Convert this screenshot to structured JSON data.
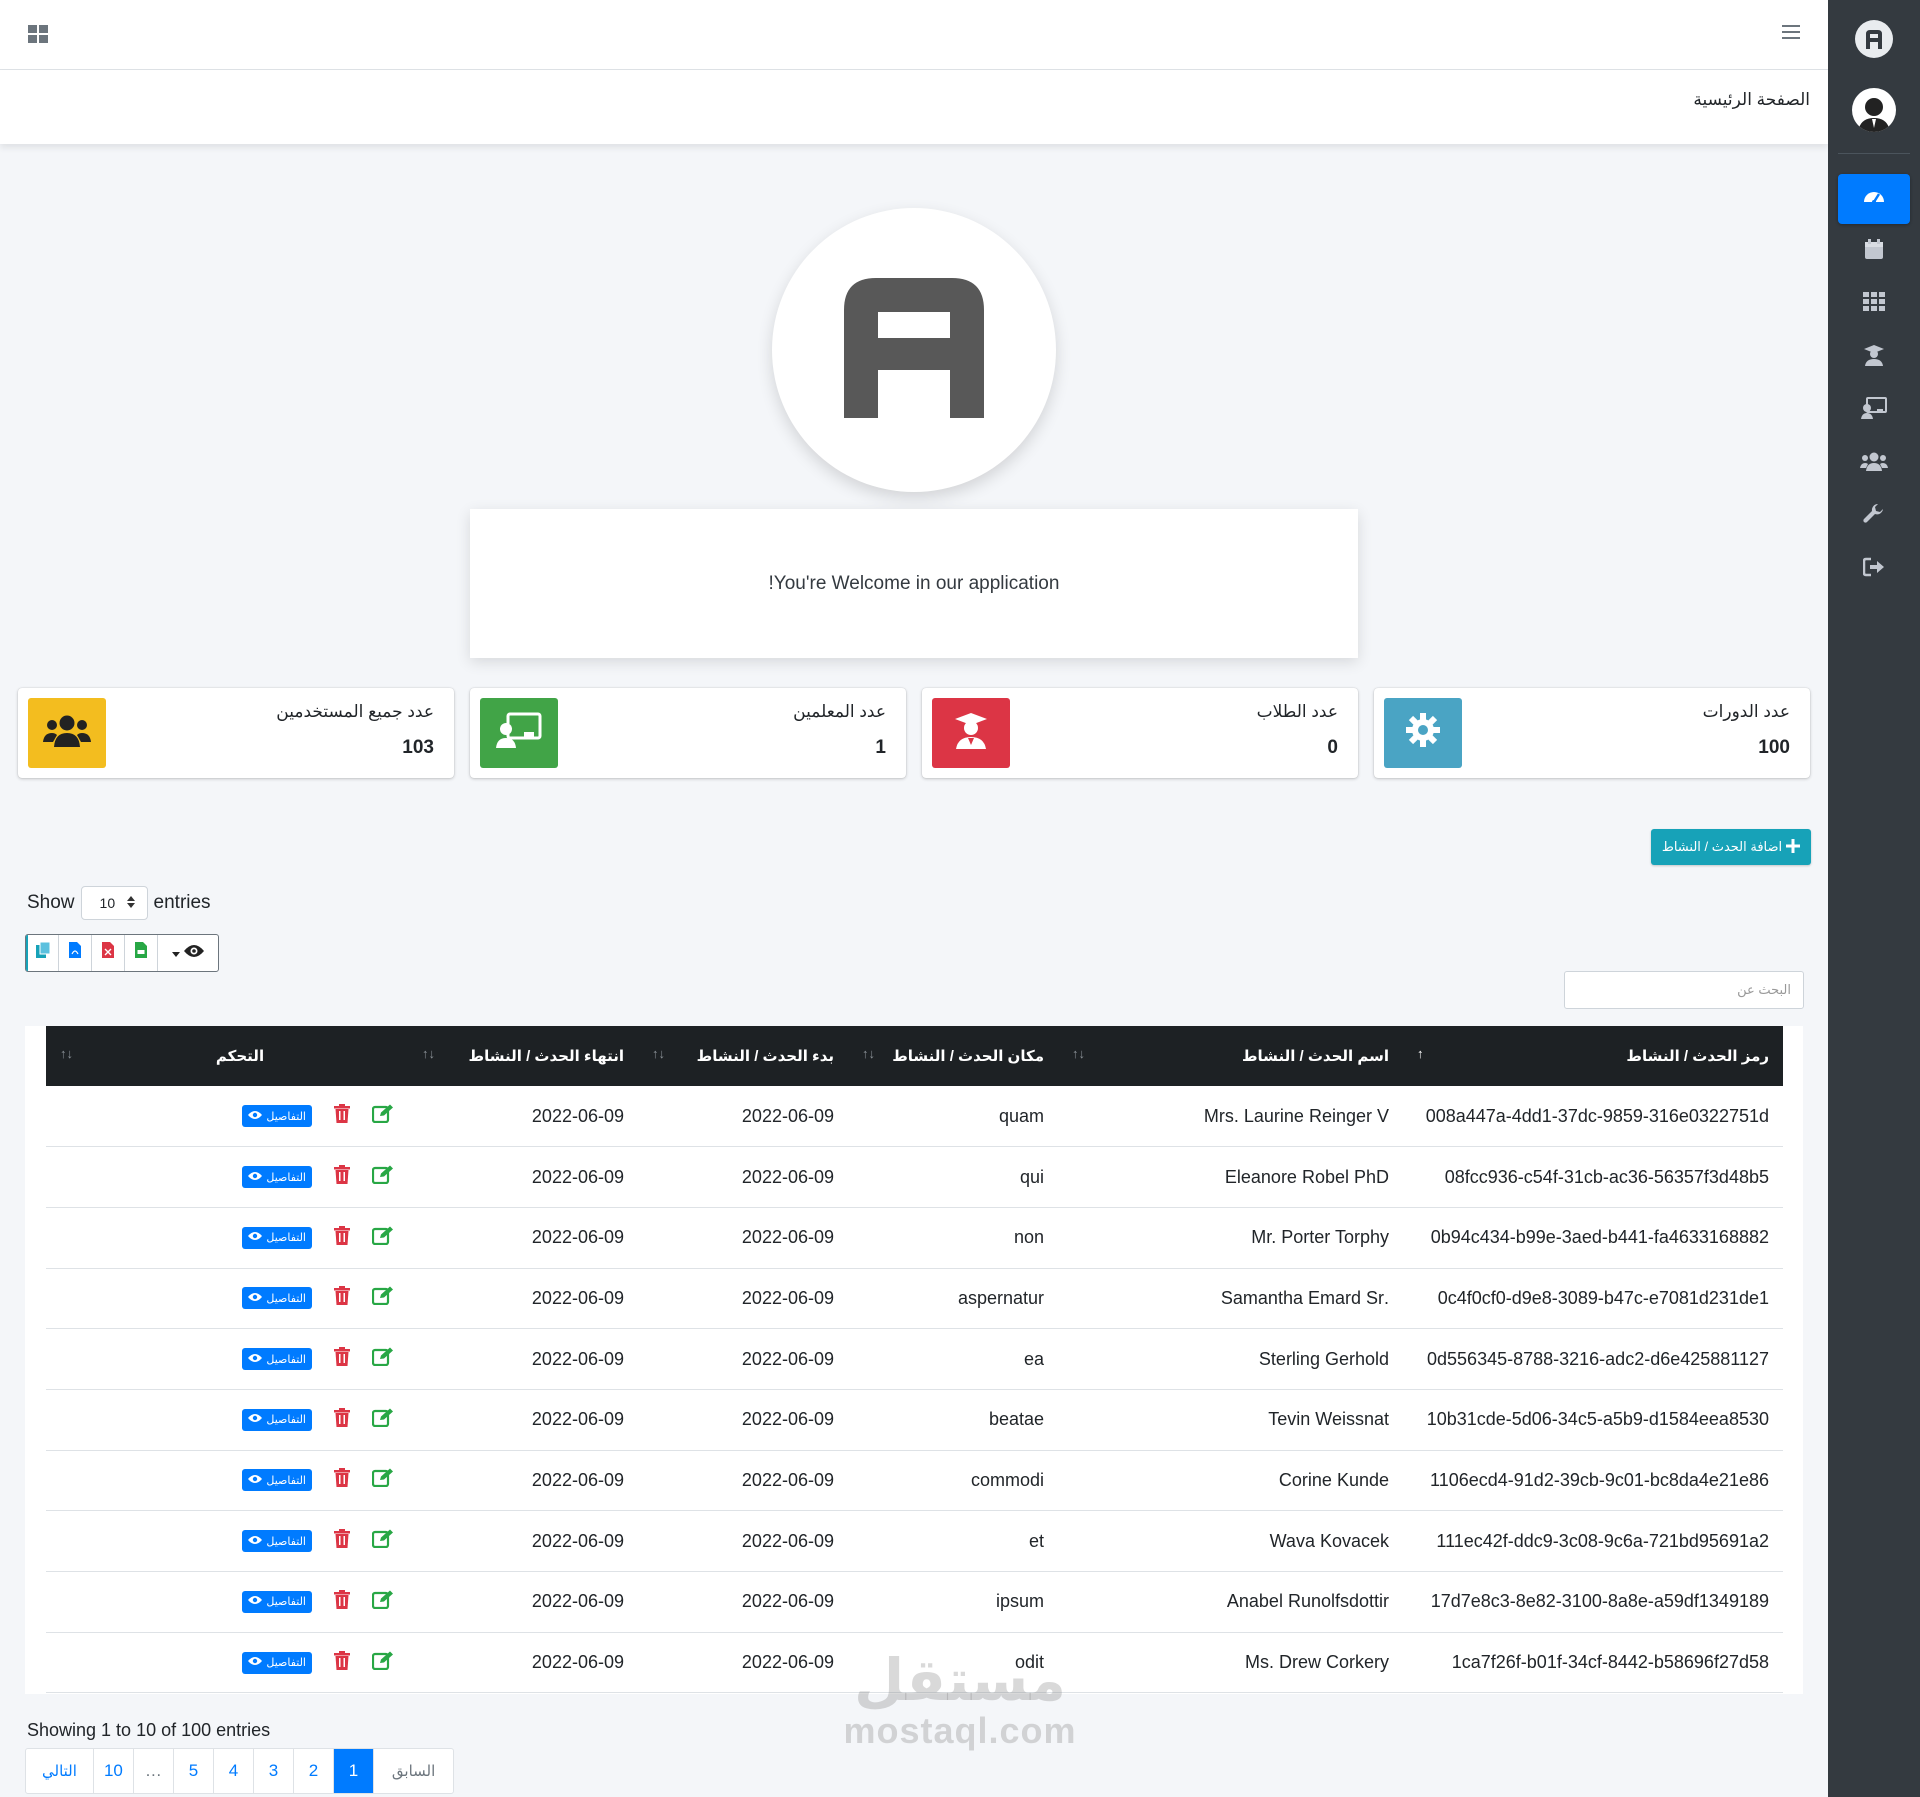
{
  "breadcrumb": {
    "title": "الصفحة الرئيسية"
  },
  "welcome": {
    "text": "!You're Welcome in our application"
  },
  "stats": [
    {
      "label": "عدد الدورات",
      "value": "100",
      "icon": "cog-icon",
      "color": "#4aa4c4"
    },
    {
      "label": "عدد الطلاب",
      "value": "0",
      "icon": "graduate-icon",
      "color": "#dc3545"
    },
    {
      "label": "عدد المعلمين",
      "value": "1",
      "icon": "teacher-icon",
      "color": "#41a447"
    },
    {
      "label": "عدد جميع المستخدمين",
      "value": "103",
      "icon": "users-icon",
      "color": "#f3bd1f"
    }
  ],
  "add_button": {
    "label": "اضافة الحدث / النشاط"
  },
  "datatable": {
    "show_label": "Show",
    "entries_label": "entries",
    "length_value": "10",
    "search_placeholder": "البحث عن",
    "info": "Showing 1 to 10 of 100 entries",
    "columns": [
      "رمز الحدث / النشاط",
      "اسم الحدث / النشاط",
      "مكان الحدث / النشاط",
      "بدء الحدث / النشاط",
      "انتهاء الحدث / النشاط",
      "التحكم"
    ],
    "details_label": "التفاصيل",
    "rows": [
      [
        "008a447a-4dd1-37dc-9859-316e0322751d",
        "Mrs. Laurine Reinger V",
        "quam",
        "2022-06-09",
        "2022-06-09"
      ],
      [
        "08fcc936-c54f-31cb-ac36-56357f3d48b5",
        "Eleanore Robel PhD",
        "qui",
        "2022-06-09",
        "2022-06-09"
      ],
      [
        "0b94c434-b99e-3aed-b441-fa4633168882",
        "Mr. Porter Torphy",
        "non",
        "2022-06-09",
        "2022-06-09"
      ],
      [
        "0c4f0cf0-d9e8-3089-b47c-e7081d231de1",
        ".Samantha Emard Sr",
        "aspernatur",
        "2022-06-09",
        "2022-06-09"
      ],
      [
        "0d556345-8788-3216-adc2-d6e425881127",
        "Sterling Gerhold",
        "ea",
        "2022-06-09",
        "2022-06-09"
      ],
      [
        "10b31cde-5d06-34c5-a5b9-d1584eea8530",
        "Tevin Weissnat",
        "beatae",
        "2022-06-09",
        "2022-06-09"
      ],
      [
        "1106ecd4-91d2-39cb-9c01-bc8da4e21e86",
        "Corine Kunde",
        "commodi",
        "2022-06-09",
        "2022-06-09"
      ],
      [
        "111ec42f-ddc9-3c08-9c6a-721bd95691a2",
        "Wava Kovacek",
        "et",
        "2022-06-09",
        "2022-06-09"
      ],
      [
        "17d7e8c3-8e82-3100-8a8e-a59df1349189",
        "Anabel Runolfsdottir",
        "ipsum",
        "2022-06-09",
        "2022-06-09"
      ],
      [
        "1ca7f26f-b01f-34cf-8442-b58696f27d58",
        "Ms. Drew Corkery",
        "odit",
        "2022-06-09",
        "2022-06-09"
      ]
    ]
  },
  "pagination": {
    "next": "التالي",
    "prev": "السابق",
    "pages": [
      "10",
      "…",
      "5",
      "4",
      "3",
      "2",
      "1"
    ],
    "active": "1"
  },
  "watermark": {
    "ar": "مستقل",
    "en": "mostaql.com"
  },
  "colors": {
    "sidebar": "#343a40",
    "primary": "#007bff",
    "table_head": "#1d2124",
    "info": "#17a2b8"
  }
}
